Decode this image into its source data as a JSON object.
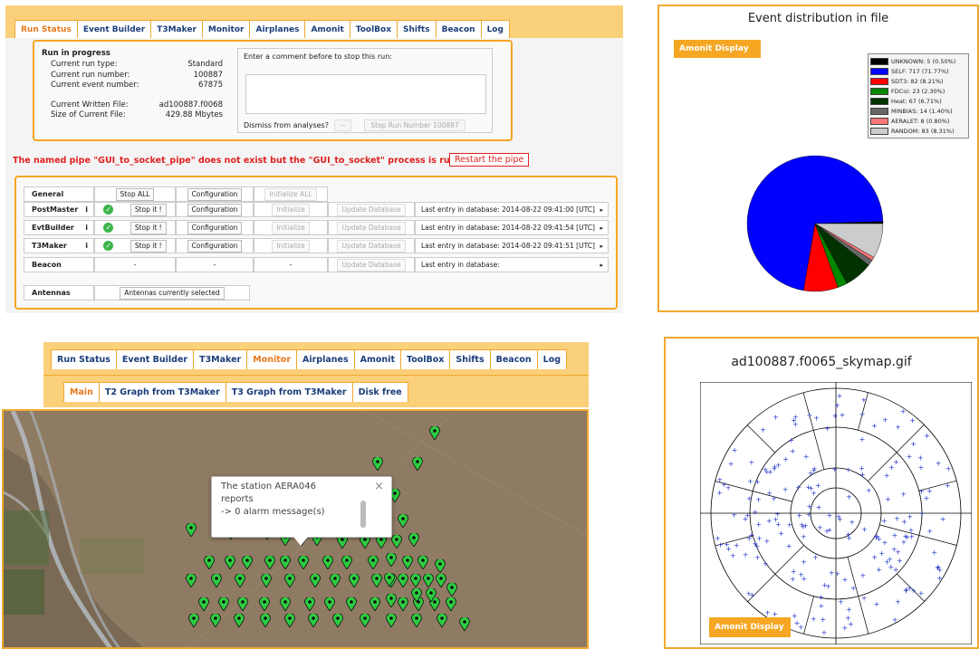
{
  "tabs": [
    "Run Status",
    "Event Builder",
    "T3Maker",
    "Monitor",
    "Airplanes",
    "Amonit",
    "ToolBox",
    "Shifts",
    "Beacon",
    "Log"
  ],
  "run": {
    "heading": "Run in progress",
    "rows": [
      [
        "Current run type:",
        "Standard"
      ],
      [
        "Current run number:",
        "100887"
      ],
      [
        "Current event number:",
        "67875"
      ],
      [
        "",
        ""
      ],
      [
        "Current Written File:",
        "ad100887.f0068"
      ],
      [
        "Size of Current File:",
        "429.88 Mbytes"
      ]
    ],
    "comment_label": "Enter a comment before to stop this run:",
    "dismiss": "Dismiss from analyses?",
    "dismiss_sel": "--",
    "stop_btn": "Stop Run Number 100887"
  },
  "warning": "The named pipe \"GUI_to_socket_pipe\" does not exist but the \"GUI_to_socket\" process is running  -->",
  "restart": "Restart the pipe",
  "ctl": {
    "general": {
      "name": "General",
      "stop": "Stop ALL",
      "config": "Configuration",
      "init": "Initialize ALL"
    },
    "procs": [
      {
        "name": "PostMaster",
        "stop": "Stop it !",
        "config": "Configuration",
        "init": "Initialize",
        "update": "Update Database",
        "last": "Last entry in database: 2014-08-22 09:41:00 [UTC]"
      },
      {
        "name": "EvtBuilder",
        "stop": "Stop it !",
        "config": "Configuration",
        "init": "Initialize",
        "update": "Update Database",
        "last": "Last entry in database: 2014-08-22 09:41:54 [UTC]"
      },
      {
        "name": "T3Maker",
        "stop": "Stop it !",
        "config": "Configuration",
        "init": "Initialize",
        "update": "Update Database",
        "last": "Last entry in database: 2014-08-22 09:41:51 [UTC]"
      }
    ],
    "beacon": {
      "name": "Beacon",
      "dash": "-",
      "update": "Update Database",
      "last": "Last entry in database:"
    },
    "antennas": {
      "name": "Antennas",
      "value": "Antennas currently selected"
    }
  },
  "pie": {
    "title": "Event distribution in file",
    "button": "Amonit Display",
    "chart_data": {
      "type": "pie",
      "title": "Event distribution in file",
      "slices": [
        {
          "label": "UNKNOWN: 5 (0.50%)",
          "value": 5,
          "color": "#000000"
        },
        {
          "label": "SELF: 717 (71.77%)",
          "value": 717,
          "color": "#0000ff"
        },
        {
          "label": "SDT3: 82 (8.21%)",
          "value": 82,
          "color": "#ff0000"
        },
        {
          "label": "FDCoi: 23 (2.30%)",
          "value": 23,
          "color": "#008800"
        },
        {
          "label": "Heat: 67 (6.71%)",
          "value": 67,
          "color": "#003300"
        },
        {
          "label": "MINBIAS: 14 (1.40%)",
          "value": 14,
          "color": "#666666"
        },
        {
          "label": "AERALET: 8 (0.80%)",
          "value": 8,
          "color": "#ff7777"
        },
        {
          "label": "RANDOM: 83 (8.31%)",
          "value": 83,
          "color": "#cccccc"
        }
      ]
    }
  },
  "monitor": {
    "tabs": [
      "Run Status",
      "Event Builder",
      "T3Maker",
      "Monitor",
      "Airplanes",
      "Amonit",
      "ToolBox",
      "Shifts",
      "Beacon",
      "Log"
    ],
    "subtabs": [
      "Main",
      "T2 Graph from T3Maker",
      "T3 Graph from T3Maker",
      "Disk free"
    ],
    "popup": {
      "line1": "The station AERA046",
      "line2": "reports",
      "line3": "-> 0 alarm message(s)",
      "close": "×"
    }
  },
  "sky": {
    "title": "ad100887.f0065_skymap.gif",
    "button": "Amonit Display"
  },
  "colors": {
    "accent": "#f5a623",
    "tab_text": "#1a3d7a",
    "active": "#e8781c",
    "pin": "#2ecc40"
  }
}
